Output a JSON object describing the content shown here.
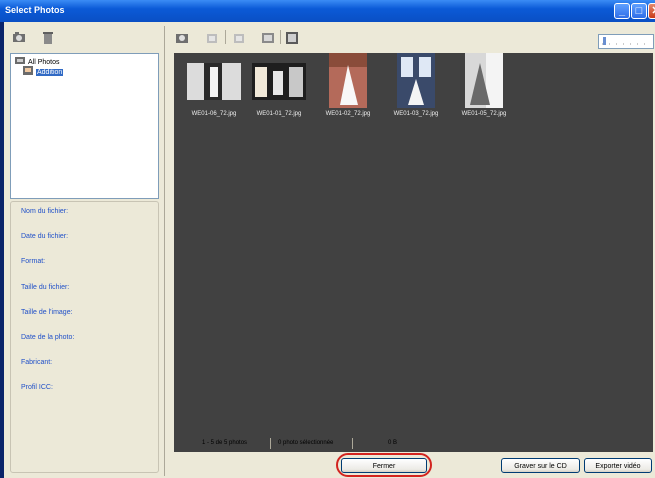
{
  "window": {
    "title": "Select Photos"
  },
  "tree": {
    "root_label": "All Photos",
    "child_label": "Addition"
  },
  "info_labels": [
    "Nom du fichier:",
    "Date du fichier:",
    "Format:",
    "Taille du fichier:",
    "Taille de l'image:",
    "Date de la photo:",
    "Fabricant:",
    "Profil ICC:"
  ],
  "thumbnails": [
    "WE01-06_72.jpg",
    "WE01-01_72.jpg",
    "WE01-02_72.jpg",
    "WE01-03_72.jpg",
    "WE01-05_72.jpg"
  ],
  "status": {
    "count": "1 - 5 de 5 photos",
    "selected": "0 photo sélectionnée",
    "size": "0 B"
  },
  "buttons": {
    "close": "Fermer",
    "burn": "Graver sur le CD",
    "export": "Exporter vidéo"
  },
  "colors": {
    "titlebar": "#0b5ad7",
    "viewer_bg": "#414141",
    "info_label": "#2050c8",
    "highlight_ring": "#d2231e"
  }
}
